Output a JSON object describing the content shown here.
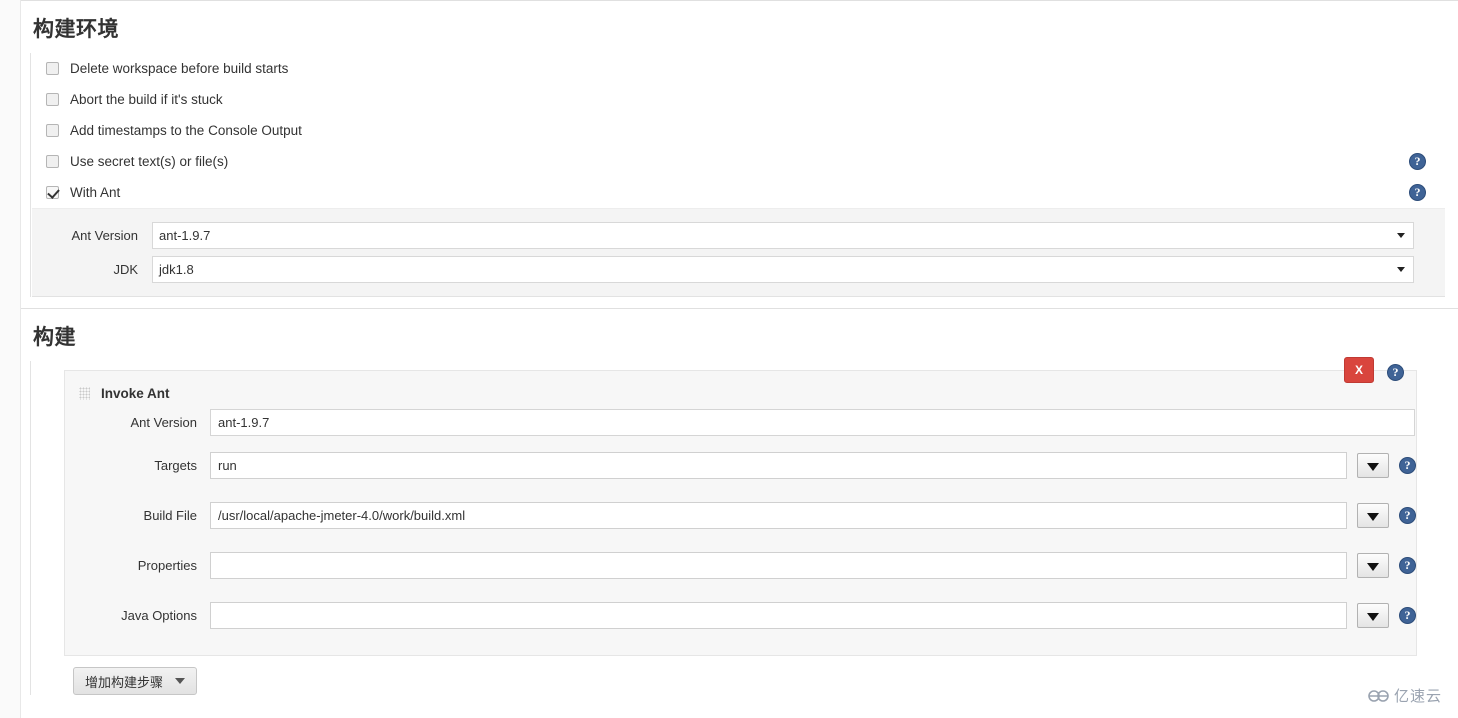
{
  "build_environment": {
    "heading": "构建环境",
    "checkboxes": [
      {
        "label": "Delete workspace before build starts",
        "checked": false,
        "help": false
      },
      {
        "label": "Abort the build if it's stuck",
        "checked": false,
        "help": false
      },
      {
        "label": "Add timestamps to the Console Output",
        "checked": false,
        "help": false
      },
      {
        "label": "Use secret text(s) or file(s)",
        "checked": false,
        "help": true
      },
      {
        "label": "With Ant",
        "checked": true,
        "help": true
      }
    ],
    "fields": [
      {
        "label": "Ant Version",
        "value": "ant-1.9.7"
      },
      {
        "label": "JDK",
        "value": "jdk1.8"
      }
    ]
  },
  "build": {
    "heading": "构建",
    "builder": {
      "title": "Invoke Ant",
      "delete_label": "X",
      "rows": [
        {
          "label": "Ant Version",
          "value": "ant-1.9.7",
          "type": "select",
          "dropdown_button": false
        },
        {
          "label": "Targets",
          "value": "run",
          "type": "text",
          "dropdown_button": true
        },
        {
          "label": "Build File",
          "value": "/usr/local/apache-jmeter-4.0/work/build.xml",
          "type": "text",
          "dropdown_button": true
        },
        {
          "label": "Properties",
          "value": "",
          "type": "text",
          "dropdown_button": true
        },
        {
          "label": "Java Options",
          "value": "",
          "type": "text",
          "dropdown_button": true
        }
      ]
    },
    "add_step_label": "增加构建步骤"
  },
  "watermark": {
    "text": "亿速云"
  },
  "icons": {
    "help": "?",
    "grip": "drag-handle"
  },
  "colors": {
    "delete_red": "#d9453d",
    "help_blue": "#3f6396",
    "panel_gray": "#f4f4f4"
  }
}
